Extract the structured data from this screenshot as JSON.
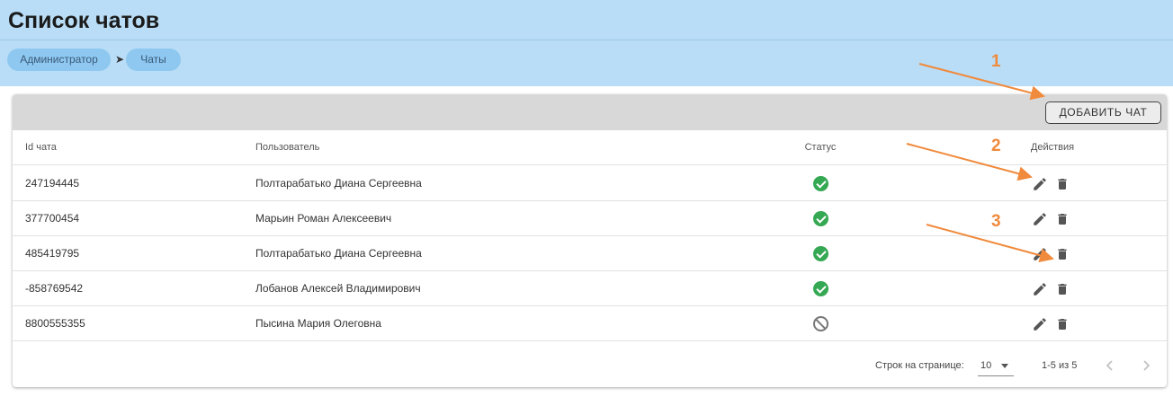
{
  "header": {
    "title": "Список чатов",
    "breadcrumbs": [
      "Администратор",
      "Чаты"
    ]
  },
  "toolbar": {
    "add_label": "ДОБАВИТЬ ЧАТ"
  },
  "table": {
    "columns": [
      "Id чата",
      "Пользователь",
      "Статус",
      "Действия"
    ],
    "rows": [
      {
        "id": "247194445",
        "user": "Полтарабатько Диана Сергеевна",
        "status": "active"
      },
      {
        "id": "377700454",
        "user": "Марьин Роман Алексеевич",
        "status": "active"
      },
      {
        "id": "485419795",
        "user": "Полтарабатько Диана Сергеевна",
        "status": "active"
      },
      {
        "id": "-858769542",
        "user": "Лобанов Алексей Владимирович",
        "status": "active"
      },
      {
        "id": "8800555355",
        "user": "Пысина Мария Олеговна",
        "status": "blocked"
      }
    ]
  },
  "pagination": {
    "rows_per_page_label": "Строк на странице:",
    "rows_per_page_value": "10",
    "range_text": "1-5 из 5"
  },
  "annotations": [
    "1",
    "2",
    "3"
  ],
  "colors": {
    "header_bg": "#b9ddf6",
    "status_active": "#34a853",
    "status_blocked": "#777777",
    "annotation": "#f08a3c"
  }
}
